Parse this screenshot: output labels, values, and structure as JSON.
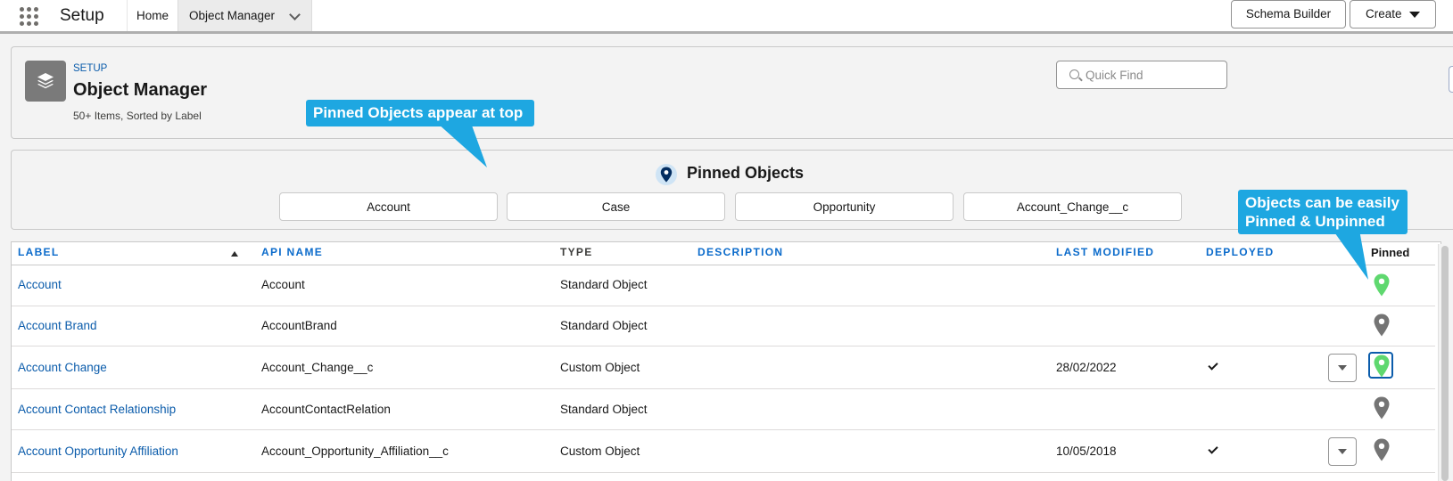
{
  "nav": {
    "app_name": "Setup",
    "tabs": [
      {
        "label": "Home"
      },
      {
        "label": "Object Manager"
      }
    ]
  },
  "header": {
    "breadcrumb": "SETUP",
    "title": "Object Manager",
    "subtitle": "50+ Items, Sorted by Label",
    "quick_find_placeholder": "Quick Find",
    "schema_builder_label": "Schema Builder",
    "create_label": "Create"
  },
  "pinned": {
    "heading": "Pinned Objects",
    "items": [
      "Account",
      "Case",
      "Opportunity",
      "Account_Change__c"
    ]
  },
  "table": {
    "columns": {
      "label": "LABEL",
      "api_name": "API NAME",
      "type": "TYPE",
      "description": "DESCRIPTION",
      "last_modified": "LAST MODIFIED",
      "deployed": "DEPLOYED",
      "pinned": "Pinned"
    },
    "sort": {
      "column": "label",
      "direction": "ascending"
    },
    "rows": [
      {
        "label": "Account",
        "api_name": "Account",
        "type": "Standard Object",
        "description": "",
        "last_modified": "",
        "deployed": false,
        "has_menu": false,
        "pinned": true
      },
      {
        "label": "Account Brand",
        "api_name": "AccountBrand",
        "type": "Standard Object",
        "description": "",
        "last_modified": "",
        "deployed": false,
        "has_menu": false,
        "pinned": false
      },
      {
        "label": "Account Change",
        "api_name": "Account_Change__c",
        "type": "Custom Object",
        "description": "",
        "last_modified": "28/02/2022",
        "deployed": true,
        "has_menu": true,
        "pinned": true
      },
      {
        "label": "Account Contact Relationship",
        "api_name": "AccountContactRelation",
        "type": "Standard Object",
        "description": "",
        "last_modified": "",
        "deployed": false,
        "has_menu": false,
        "pinned": false
      },
      {
        "label": "Account Opportunity Affiliation",
        "api_name": "Account_Opportunity_Affiliation__c",
        "type": "Custom Object",
        "description": "",
        "last_modified": "10/05/2018",
        "deployed": true,
        "has_menu": true,
        "pinned": false
      }
    ]
  },
  "callouts": {
    "pinned_top": "Pinned Objects appear at top",
    "pin_unpin_line1": "Objects can be easily",
    "pin_unpin_line2": "Pinned & Unpinned"
  },
  "colors": {
    "link": "#0b5cab",
    "callout": "#1ea7e1",
    "pin_active": "#5fd86f",
    "pin_inactive": "#747474",
    "pin_badge": "#032d60"
  },
  "icons": {
    "waffle": "app-launcher-icon",
    "object_manager": "layers-icon",
    "search": "search-icon",
    "caret": "caret-down-icon",
    "pin": "map-pin-icon",
    "check": "check-icon"
  }
}
